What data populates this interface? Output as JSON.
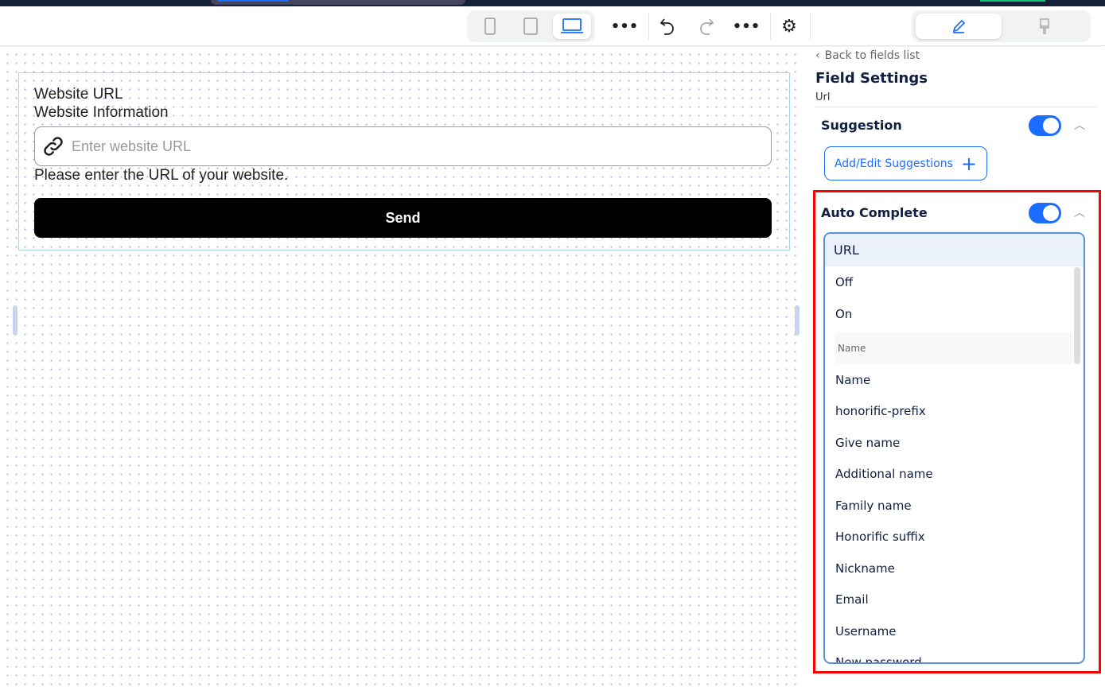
{
  "toolbar": {
    "devices": [
      "mobile-icon",
      "tablet-icon",
      "desktop-icon"
    ],
    "active_device": "desktop",
    "more_label": "•••",
    "modes": [
      "edit-icon",
      "style-brush-icon"
    ]
  },
  "form": {
    "title": "Website URL",
    "label": "Website Information",
    "placeholder": "Enter website URL",
    "help": "Please enter the URL of your website.",
    "send_label": "Send"
  },
  "panel": {
    "back_label": "Back to fields list",
    "title": "Field Settings",
    "subtitle": "Url",
    "suggestion": {
      "label": "Suggestion",
      "enabled": true,
      "button": "Add/Edit Suggestions"
    },
    "autocomplete": {
      "label": "Auto Complete",
      "enabled": true,
      "selected": "URL",
      "options_top": [
        "Off",
        "On"
      ],
      "group_label": "Name",
      "options": [
        "Name",
        "honorific-prefix",
        "Give name",
        "Additional name",
        "Family name",
        "Honorific suffix",
        "Nickname",
        "Email",
        "Username",
        "New password"
      ]
    }
  },
  "colors": {
    "accent": "#1a6dff",
    "highlight_border": "#ff0000"
  }
}
